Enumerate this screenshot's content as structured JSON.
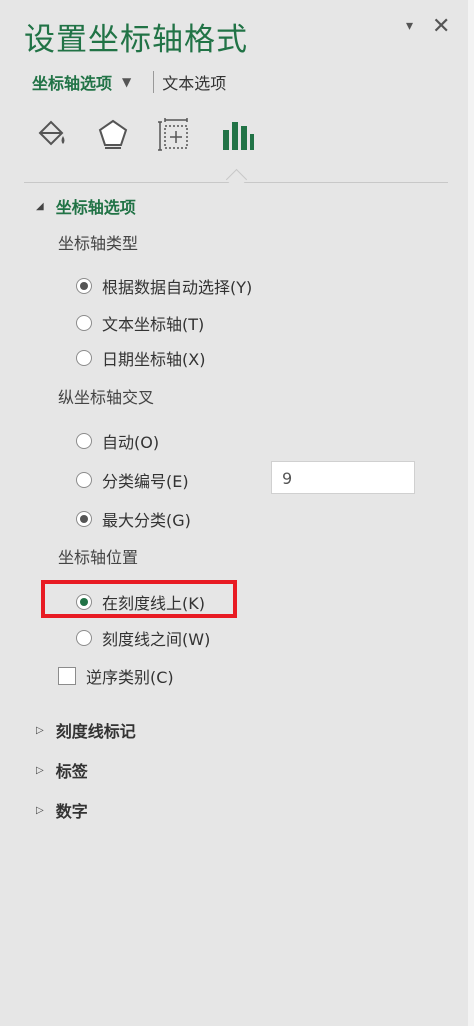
{
  "pane": {
    "title": "设置坐标轴格式",
    "pin_icon": "▾",
    "close_icon": "✕"
  },
  "tabs": {
    "axis_options": "坐标轴选项",
    "text_options": "文本选项"
  },
  "icons": [
    "fill-bucket-icon",
    "pentagon-effects-icon",
    "size-properties-icon",
    "bar-chart-icon"
  ],
  "sections": {
    "axis_options": {
      "label": "坐标轴选项",
      "axis_type": {
        "label": "坐标轴类型",
        "options": [
          "根据数据自动选择(Y)",
          "文本坐标轴(T)",
          "日期坐标轴(X)"
        ],
        "selected": 0
      },
      "vertical_cross": {
        "label": "纵坐标轴交叉",
        "options": [
          "自动(O)",
          "分类编号(E)",
          "最大分类(G)"
        ],
        "category_number_value": "9",
        "selected": 2
      },
      "axis_position": {
        "label": "坐标轴位置",
        "options": [
          "在刻度线上(K)",
          "刻度线之间(W)"
        ],
        "selected": 0
      },
      "reverse_order": {
        "label": "逆序类别(C)",
        "checked": false
      }
    },
    "tick_marks": "刻度线标记",
    "labels": "标签",
    "number": "数字"
  },
  "colors": {
    "accent_green": "#217346",
    "highlight_red": "#e81b23"
  }
}
